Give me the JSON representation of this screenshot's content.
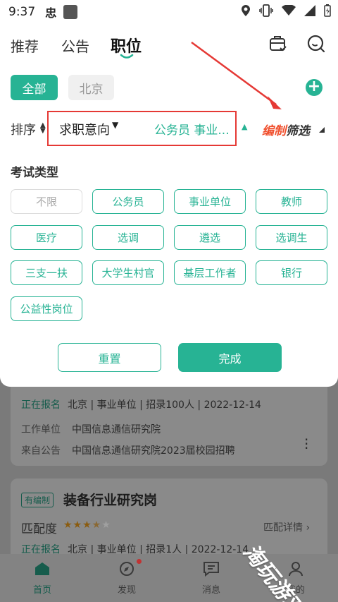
{
  "status_bar": {
    "time": "9:37",
    "app_glyph": "忠"
  },
  "header": {
    "tabs": [
      {
        "label": "推荐"
      },
      {
        "label": "公告"
      },
      {
        "label": "职位"
      }
    ],
    "active_tab": "职位",
    "icons": [
      "briefcase-icon",
      "search-icon"
    ]
  },
  "cities": {
    "active": "全部",
    "other": "北京"
  },
  "filter_bar": {
    "sort_label": "排序",
    "intent_label": "求职意向",
    "intent_value": "公务员 事业...",
    "edit_filter_a": "编制",
    "edit_filter_b": "筛选"
  },
  "exam_types": {
    "title": "考试类型",
    "options": [
      "不限",
      "公务员",
      "事业单位",
      "教师",
      "医疗",
      "选调",
      "遴选",
      "选调生",
      "三支一扶",
      "大学生村官",
      "基层工作者",
      "银行",
      "公益性岗位"
    ]
  },
  "actions": {
    "reset": "重置",
    "done": "完成"
  },
  "card1": {
    "status": "正在报名",
    "meta": "北京 | 事业单位 | 招录100人 | 2022-12-14",
    "employer_label": "工作单位",
    "employer": "中国信息通信研究院",
    "source_label": "来自公告",
    "source": "中国信息通信研究院2023届校园招聘"
  },
  "card2": {
    "tag": "有编制",
    "title": "装备行业研究岗",
    "match_label": "匹配度",
    "rating": 3.5,
    "detail_link": "匹配详情",
    "status": "正在报名",
    "meta": "北京 | 事业单位 | 招录1人 | 2022-12-14"
  },
  "bottom_nav": [
    {
      "label": "首页"
    },
    {
      "label": "发现"
    },
    {
      "label": "消息"
    },
    {
      "label": "我的"
    }
  ],
  "watermark": "淘玩游戏",
  "colors": {
    "accent": "#27b394",
    "highlight": "#e53935",
    "edit": "#f0502e"
  }
}
